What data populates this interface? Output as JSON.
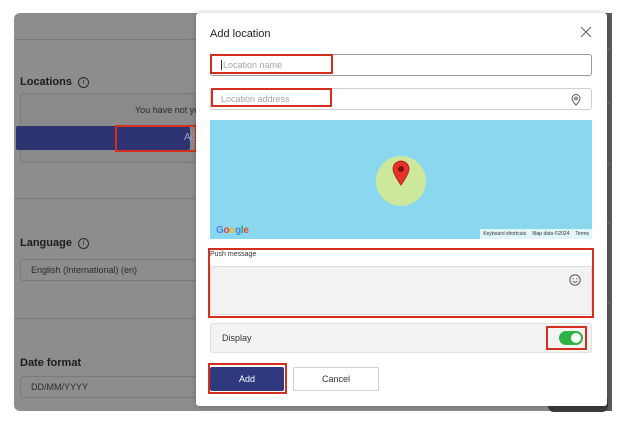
{
  "background": {
    "locations": {
      "heading": "Locations",
      "info_icon": "i",
      "empty_text": "You have not ye",
      "add_button_label": "Ad"
    },
    "language": {
      "heading": "Language",
      "info_icon": "i",
      "value": "English (International) (en)"
    },
    "date_format": {
      "heading": "Date format",
      "value": "DD/MM/YYYY"
    }
  },
  "modal": {
    "title": "Add location",
    "close_icon": "close-icon",
    "location_name_placeholder": "Location name",
    "location_address_placeholder": "Location address",
    "address_icon": "map-pin-icon",
    "map": {
      "logo": [
        "G",
        "o",
        "o",
        "g",
        "l",
        "e"
      ],
      "logo_colors": [
        "#4285F4",
        "#EA4335",
        "#FBBC05",
        "#4285F4",
        "#34A853",
        "#EA4335"
      ],
      "attribution": [
        "Keyboard shortcuts",
        "Map data ©2024",
        "Terms"
      ],
      "marker_color": "#e5322b",
      "area_color": "#cde79b"
    },
    "push_message_label": "Push message",
    "emoji_icon": "smiley-icon",
    "display_label": "Display",
    "display_toggle_on": true,
    "toggle_color": "#2fb344",
    "add_button": "Add",
    "cancel_button": "Cancel"
  },
  "colors": {
    "primary": "#2f3a7e",
    "highlight": "#d42e1e"
  }
}
